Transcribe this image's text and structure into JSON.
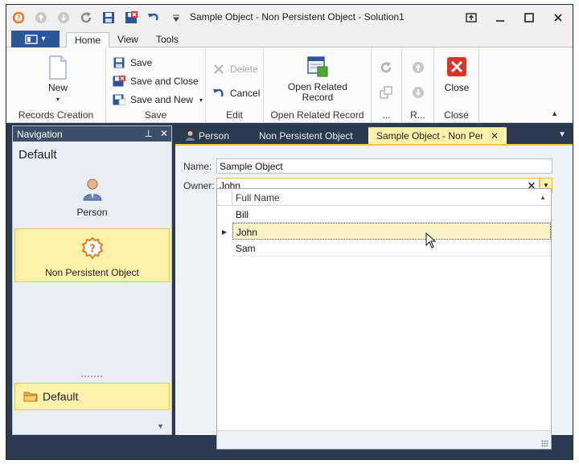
{
  "window": {
    "title": "Sample Object - Non Persistent Object - Solution1",
    "controls": [
      "restore-ribbon",
      "minimize",
      "maximize",
      "close"
    ]
  },
  "quick_access": [
    "app-icon",
    "back-icon",
    "forward-icon",
    "refresh-icon",
    "save-icon",
    "save-close-icon",
    "undo-icon",
    "customize-icon"
  ],
  "ribbon_tabs": {
    "home": "Home",
    "view": "View",
    "tools": "Tools"
  },
  "ribbon": {
    "records_creation": {
      "caption": "Records Creation",
      "new_label": "New"
    },
    "save": {
      "caption": "Save",
      "save_label": "Save",
      "save_close_label": "Save and Close",
      "save_new_label": "Save and New"
    },
    "edit": {
      "caption": "Edit",
      "delete_label": "Delete",
      "cancel_label": "Cancel"
    },
    "open_related": {
      "caption": "Open Related Record",
      "button_label_1": "Open Related",
      "button_label_2": "Record"
    },
    "navigation_group": {
      "caption": "..."
    },
    "records_nav_group": {
      "caption": "R..."
    },
    "close": {
      "caption": "Close",
      "close_label": "Close"
    }
  },
  "navigation": {
    "header": "Navigation",
    "group_title": "Default",
    "items": [
      {
        "label": "Person",
        "icon": "person-icon"
      },
      {
        "label": "Non Persistent Object",
        "icon": "gear-question-icon"
      }
    ],
    "bottom_group": "Default"
  },
  "doc_tabs": [
    {
      "label": "Person"
    },
    {
      "label": "Non Persistent Object"
    },
    {
      "label": "Sample Object - Non Persis"
    }
  ],
  "detail": {
    "name_label": "Name:",
    "name_value": "Sample Object",
    "owner_label": "Owner:",
    "owner_value": "John"
  },
  "lookup": {
    "column": "Full Name",
    "rows": [
      "Bill",
      "John",
      "Sam"
    ],
    "selected_index": 1
  },
  "colors": {
    "accent": "#2b579a",
    "frame": "#2b3a4f",
    "highlight": "#fdf2a9",
    "highlight_border": "#e6c64a"
  }
}
